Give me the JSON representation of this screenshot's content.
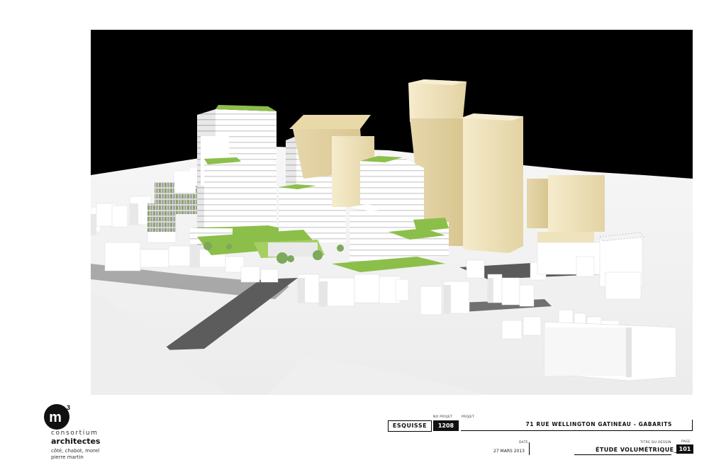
{
  "logo": {
    "mark": "m",
    "superscript": "3",
    "line1": "consortium",
    "line2": "architectes",
    "line3": "côté, chabot, morel pierre martin"
  },
  "titleblock": {
    "stage": "ESQUISSE",
    "project_no_label": "NO PROJET",
    "project_no": "1208",
    "project_label": "PROJET",
    "project": "71 RUE WELLINGTON GATINEAU - GABARITS",
    "date_label": "DATE",
    "date": "27 MARS 2013",
    "sheet_title_label": "TITRE DU DESSIN",
    "sheet_title": "ÉTUDE VOLUMÉTRIQUE_1",
    "page_label": "PAGE",
    "page": "101"
  },
  "colors": {
    "sky": "#000000",
    "ground": "#f2f2f2",
    "proposed": "#ffffff",
    "existing_tower": "#efe4c0",
    "green_roof": "#8cbf4a",
    "road": "#5c5c5c"
  }
}
